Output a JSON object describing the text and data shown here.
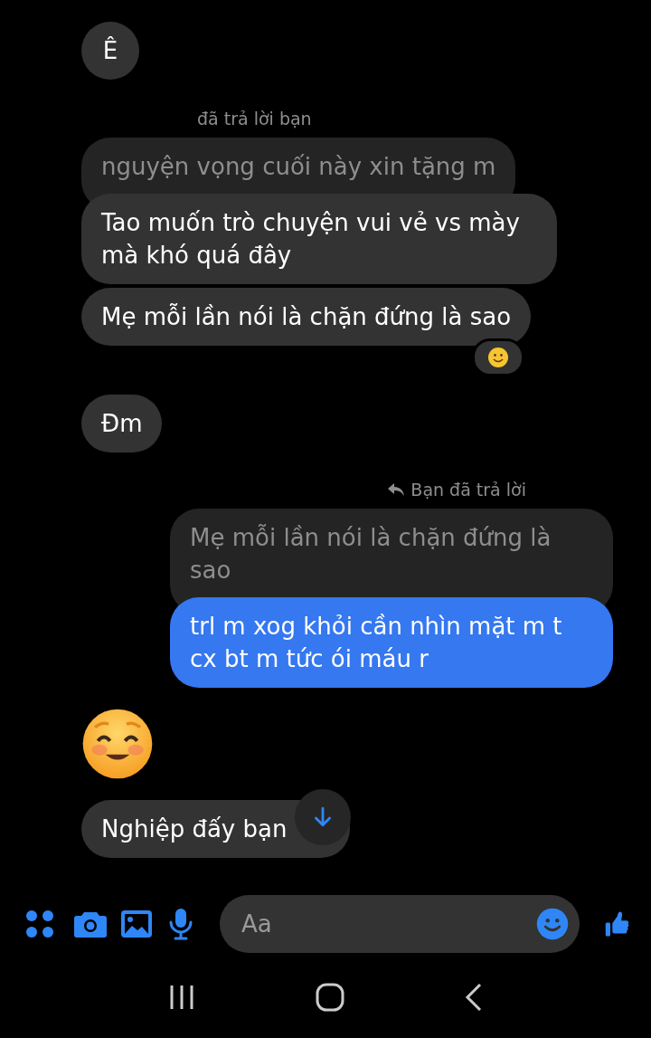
{
  "messages": [
    {
      "kind": "text",
      "outgoing": false,
      "text": "Ê"
    },
    {
      "kind": "reply",
      "outgoing": false,
      "reply_label": "đã trả lời bạn",
      "quote": "nguyện vọng cuối này xin tặng m",
      "text": "Tao muốn trò chuyện vui vẻ vs mày mà khó quá đây"
    },
    {
      "kind": "text",
      "outgoing": false,
      "text": "Mẹ mỗi lần nói là chặn đứng là sao",
      "reacted": true
    },
    {
      "kind": "text",
      "outgoing": false,
      "text": "Đm"
    },
    {
      "kind": "reply",
      "outgoing": true,
      "reply_label": "Bạn đã trả lời",
      "quote": "Mẹ mỗi lần nói là chặn đứng là sao",
      "text": "trl m xog khỏi cần nhìn mặt m t cx bt m tức ói máu r"
    },
    {
      "kind": "emoji",
      "outgoing": false
    },
    {
      "kind": "text",
      "outgoing": false,
      "text": "Nghiệp đấy bạn",
      "covered": true
    }
  ],
  "composer": {
    "placeholder": "Aa"
  }
}
